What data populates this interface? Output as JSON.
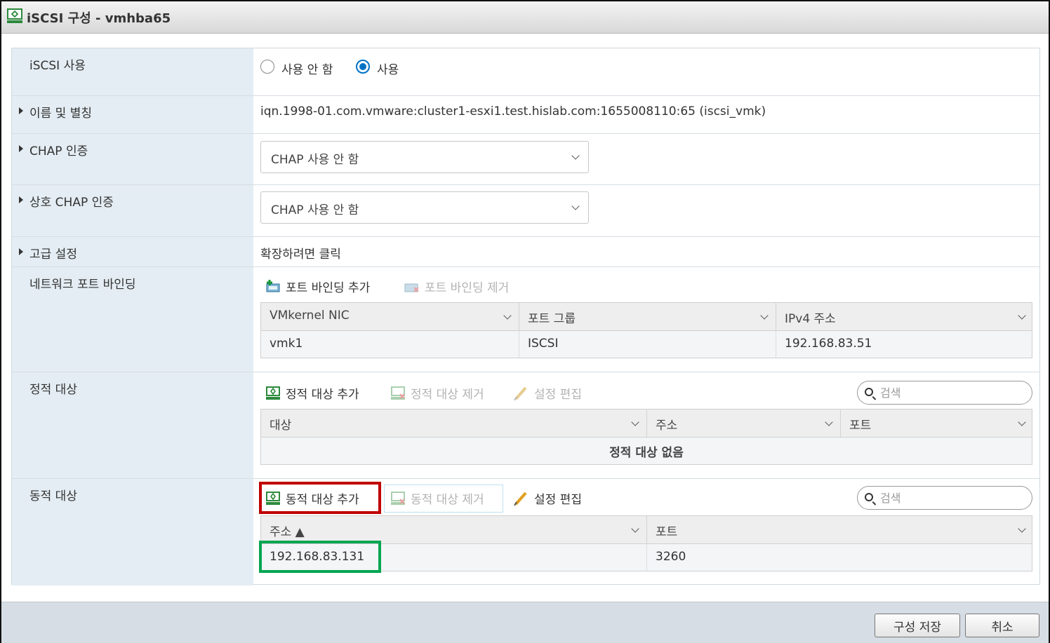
{
  "window": {
    "title": "iSCSI 구성 - vmhba65"
  },
  "rows": {
    "enable": {
      "label": "iSCSI 사용",
      "option_off": "사용 안 함",
      "option_on": "사용",
      "selected": "사용"
    },
    "name": {
      "label": "이름 및 별칭",
      "value": "iqn.1998-01.com.vmware:cluster1-esxi1.test.hislab.com:1655008110:65 (iscsi_vmk)"
    },
    "chap": {
      "label": "CHAP 인증",
      "value": "CHAP 사용 안 함"
    },
    "mutual_chap": {
      "label": "상호 CHAP 인증",
      "value": "CHAP 사용 안 함"
    },
    "advanced": {
      "label": "고급 설정",
      "value": "확장하려면 클릭"
    },
    "port_binding": {
      "label": "네트워크 포트 바인딩",
      "add": "포트 바인딩 추가",
      "remove": "포트 바인딩 제거",
      "columns": [
        "VMkernel NIC",
        "포트 그룹",
        "IPv4 주소"
      ],
      "rows": [
        [
          "vmk1",
          "ISCSI",
          "192.168.83.51"
        ]
      ]
    },
    "static": {
      "label": "정적 대상",
      "add": "정적 대상 추가",
      "remove": "정적 대상 제거",
      "edit": "설정 편집",
      "search_placeholder": "검색",
      "columns": [
        "대상",
        "주소",
        "포트"
      ],
      "empty": "정적 대상 없음"
    },
    "dynamic": {
      "label": "동적 대상",
      "add": "동적 대상 추가",
      "remove": "동적 대상 제거",
      "edit": "설정 편집",
      "search_placeholder": "검색",
      "columns": [
        "주소 ▲",
        "포트"
      ],
      "rows": [
        [
          "192.168.83.131",
          "3260"
        ]
      ]
    }
  },
  "footer": {
    "save": "구성 저장",
    "cancel": "취소"
  },
  "colors": {
    "accent": "#0072c6",
    "highlight_red": "#c00000",
    "highlight_green": "#00a651"
  }
}
